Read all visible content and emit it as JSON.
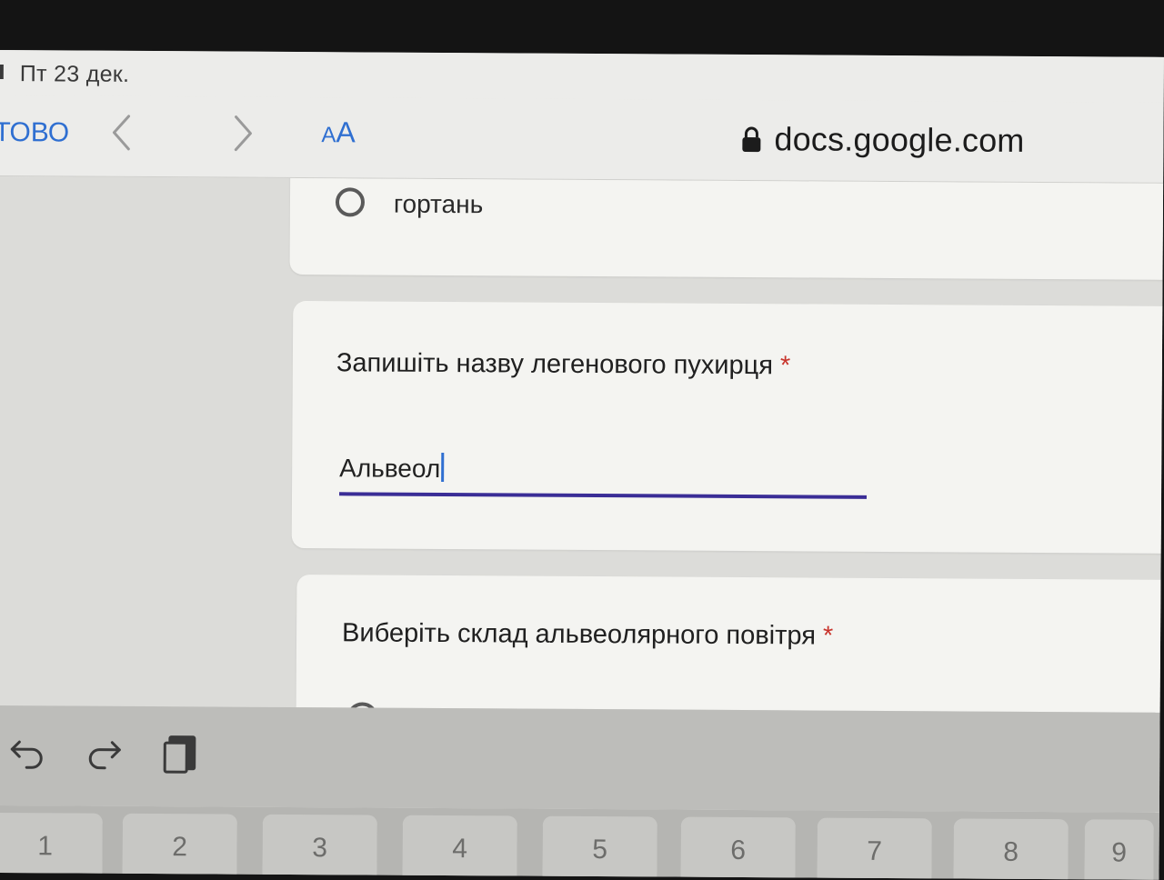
{
  "status_bar": {
    "date": "Пт 23 дек."
  },
  "browser": {
    "done_label": "ТОВО",
    "text_size": {
      "small": "A",
      "big": "A"
    },
    "url": "docs.google.com",
    "icons": [
      "back-chevron-icon",
      "forward-chevron-icon",
      "lock-icon"
    ]
  },
  "form": {
    "prev_option": {
      "label": "гортань",
      "selected": false
    },
    "question1": {
      "title": "Запишіть назву легенового пухирця",
      "required_mark": "*",
      "answer": "Альвеол"
    },
    "question2": {
      "title": "Виберіть склад альвеолярного повітря",
      "required_mark": "*"
    }
  },
  "keyboard": {
    "shortcut_icons": [
      "undo-icon",
      "redo-icon",
      "paste-icon"
    ],
    "number_keys": [
      "1",
      "2",
      "3",
      "4",
      "5",
      "6",
      "7",
      "8",
      "9"
    ]
  },
  "colors": {
    "accent": "#2f6fd1",
    "field_underline": "#3a2d96",
    "required": "#c8342c"
  }
}
